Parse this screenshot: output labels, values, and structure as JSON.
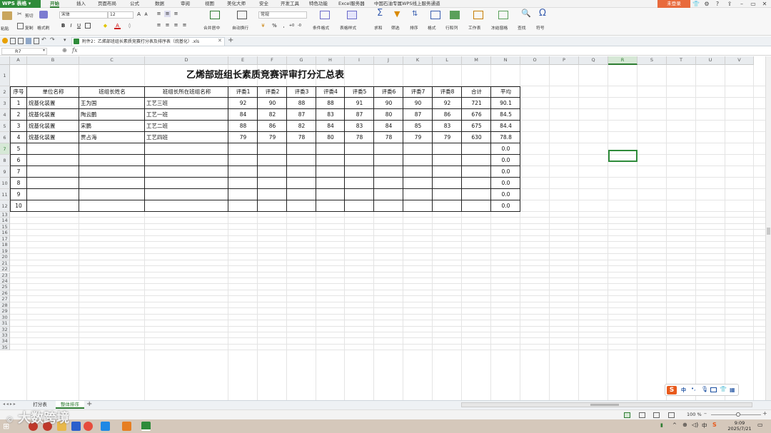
{
  "app": {
    "name": "WPS 表格"
  },
  "menu": {
    "tabs": [
      "开始",
      "插入",
      "页面布局",
      "公式",
      "数据",
      "审阅",
      "视图",
      "美化大师",
      "安全",
      "开发工具",
      "特色功能",
      "Excel服务器",
      "中国石油专属WPS线上服务通道"
    ],
    "login": "未登录"
  },
  "ribbon": {
    "paste": "粘贴",
    "cut": "剪切",
    "copy": "复制",
    "format_painter": "格式刷",
    "font_name": "宋体",
    "font_size": "12",
    "merge_center": "合并居中",
    "wrap": "自动换行",
    "number_format": "常规",
    "cond_format": "条件格式",
    "table_style": "表格样式",
    "sum": "求和",
    "filter": "筛选",
    "sort": "排序",
    "format": "格式",
    "rows_cols": "行和列",
    "worksheet": "工作表",
    "freeze": "冻结窗格",
    "find": "查找",
    "symbol": "符号"
  },
  "doc_tab": "附件2：乙烯部班组长素质竞赛打分表及排序表（烷基化）.xls",
  "name_box": "R7",
  "fx": "fx",
  "columns": [
    "A",
    "B",
    "C",
    "D",
    "E",
    "F",
    "G",
    "H",
    "I",
    "J",
    "K",
    "L",
    "M",
    "N",
    "O",
    "P",
    "Q",
    "R",
    "S",
    "T",
    "U",
    "V"
  ],
  "selected_column": "R",
  "selected_row": "7",
  "rows": [
    "1",
    "2",
    "3",
    "4",
    "5",
    "6",
    "7",
    "8",
    "9",
    "10",
    "11",
    "12",
    "13",
    "14",
    "15",
    "16",
    "17",
    "18",
    "19",
    "20",
    "21",
    "22",
    "23",
    "24",
    "25",
    "26",
    "27",
    "28",
    "29",
    "30",
    "31",
    "32",
    "33",
    "34",
    "35"
  ],
  "sheet": {
    "title": "乙烯部班组长素质竞赛评审打分汇总表",
    "headers": [
      "序号",
      "单位名称",
      "班组长姓名",
      "班组长所在班组名称",
      "评委1",
      "评委2",
      "评委3",
      "评委4",
      "评委5",
      "评委6",
      "评委7",
      "评委8",
      "合计",
      "平均"
    ],
    "data": [
      [
        "1",
        "烷基化装置",
        "王为国",
        "工艺三班",
        "92",
        "90",
        "88",
        "88",
        "91",
        "90",
        "90",
        "92",
        "721",
        "90.1"
      ],
      [
        "2",
        "烷基化装置",
        "陶云鹏",
        "工艺一班",
        "84",
        "82",
        "87",
        "83",
        "87",
        "80",
        "87",
        "86",
        "676",
        "84.5"
      ],
      [
        "3",
        "烷基化装置",
        "宋鹏",
        "工艺二班",
        "88",
        "86",
        "82",
        "84",
        "83",
        "84",
        "85",
        "83",
        "675",
        "84.4"
      ],
      [
        "4",
        "烷基化装置",
        "贾占海",
        "工艺四班",
        "79",
        "79",
        "78",
        "80",
        "78",
        "78",
        "79",
        "79",
        "630",
        "78.8"
      ],
      [
        "5",
        "",
        "",
        "",
        "",
        "",
        "",
        "",
        "",
        "",
        "",
        "",
        "",
        "0.0"
      ],
      [
        "6",
        "",
        "",
        "",
        "",
        "",
        "",
        "",
        "",
        "",
        "",
        "",
        "",
        "0.0"
      ],
      [
        "7",
        "",
        "",
        "",
        "",
        "",
        "",
        "",
        "",
        "",
        "",
        "",
        "",
        "0.0"
      ],
      [
        "8",
        "",
        "",
        "",
        "",
        "",
        "",
        "",
        "",
        "",
        "",
        "",
        "",
        "0.0"
      ],
      [
        "9",
        "",
        "",
        "",
        "",
        "",
        "",
        "",
        "",
        "",
        "",
        "",
        "",
        "0.0"
      ],
      [
        "10",
        "",
        "",
        "",
        "",
        "",
        "",
        "",
        "",
        "",
        "",
        "",
        "",
        "0.0"
      ]
    ]
  },
  "sheet_tabs": [
    "打分表",
    "整体排序"
  ],
  "active_sheet_tab": "整体排序",
  "status": {
    "zoom": "100 %"
  },
  "taskbar": {
    "time": "9:09",
    "date": "2025/7/21",
    "ime_lang": "中"
  },
  "watermark": "大数跨境",
  "colors": {
    "accent": "#2e7d32",
    "login": "#e86a3c",
    "taskbar": "#d5c8bb"
  }
}
